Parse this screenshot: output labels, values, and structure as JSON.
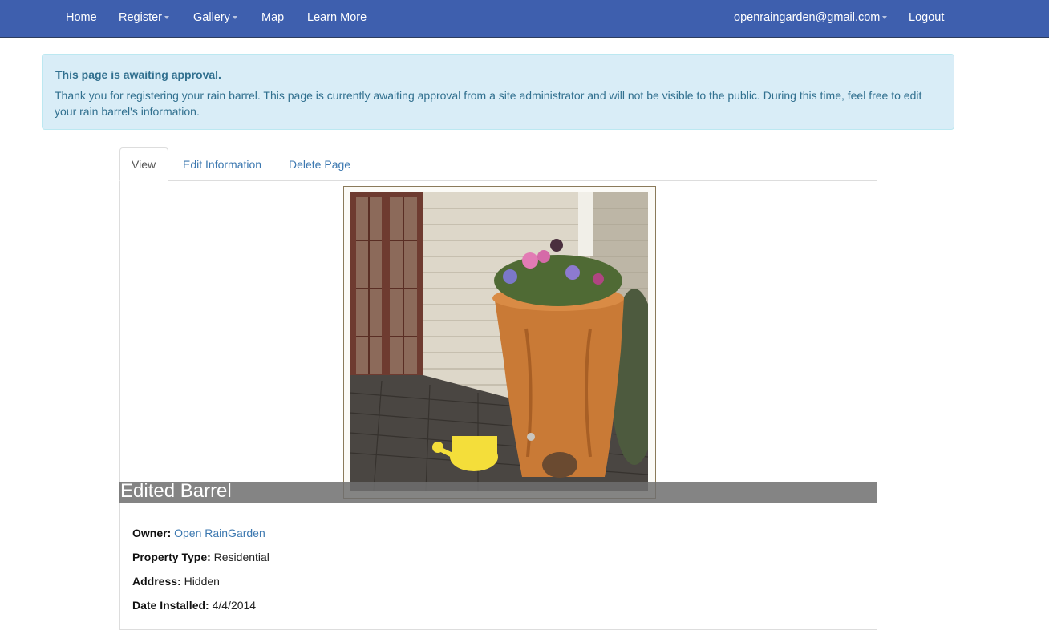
{
  "navbar": {
    "left": [
      {
        "label": "Home"
      },
      {
        "label": "Register",
        "dropdown": true
      },
      {
        "label": "Gallery",
        "dropdown": true
      },
      {
        "label": "Map"
      },
      {
        "label": "Learn More"
      }
    ],
    "account": {
      "label": "openraingarden@gmail.com",
      "dropdown": true
    },
    "logout": "Logout"
  },
  "alert": {
    "title": "This page is awaiting approval.",
    "text": "Thank you for registering your rain barrel. This page is currently awaiting approval from a site administrator and will not be visible to the public. During this time, feel free to edit your rain barrel's information."
  },
  "tabs": [
    {
      "label": "View",
      "active": true
    },
    {
      "label": "Edit Information",
      "active": false
    },
    {
      "label": "Delete Page",
      "active": false
    }
  ],
  "barrel": {
    "title": "Edited Barrel",
    "photo": "rain-barrel-planter-photo",
    "details": {
      "owner_label": "Owner:",
      "owner_value": "Open RainGarden",
      "property_label": "Property Type:",
      "property_value": "Residential",
      "address_label": "Address:",
      "address_value": "Hidden",
      "date_label": "Date Installed:",
      "date_value": "4/4/2014"
    }
  },
  "colors": {
    "navbar": "#3e5fae",
    "alert_bg": "#d9edf7",
    "alert_text": "#31708f",
    "link": "#3c78b0"
  }
}
